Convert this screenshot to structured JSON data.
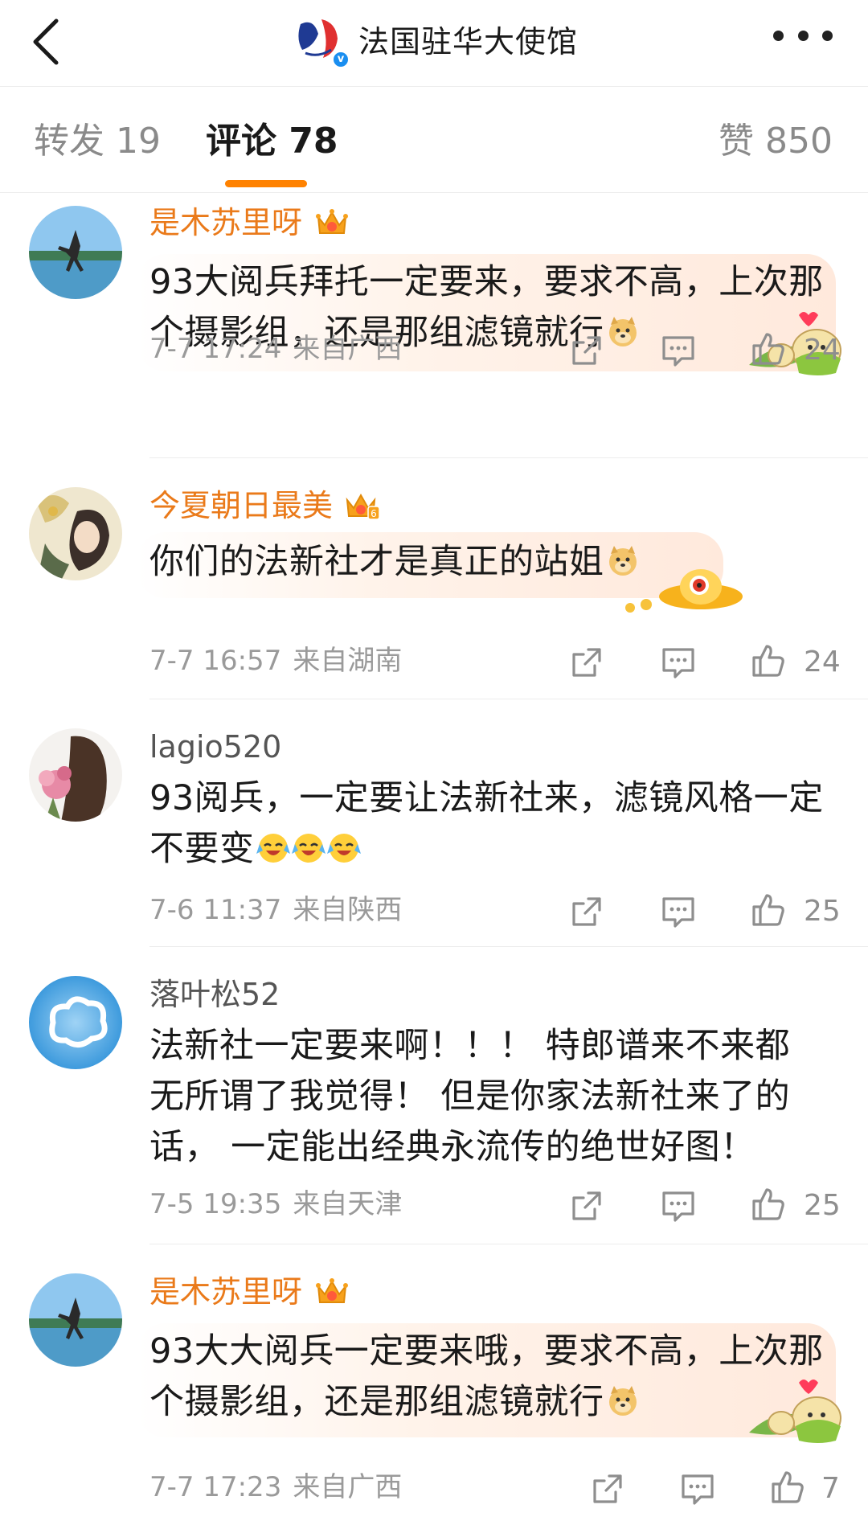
{
  "header": {
    "title": "法国驻华大使馆",
    "back_icon": "back-arrow-icon",
    "more_icon": "more-dots-icon",
    "verified_mark": "v"
  },
  "tabs": {
    "reposts": "转发 19",
    "comments": "评论 78",
    "likes": "赞 850",
    "active": "comments",
    "accent_color": "#ff8200"
  },
  "comments": [
    {
      "username": "是木苏里呀",
      "member": true,
      "text": "93大阅兵拜托一定要来，要求不高，上次那个摄影组，还是那组滤镜就行",
      "emoji": [
        "doge"
      ],
      "time": "7-7 17:24",
      "location": "来自广西",
      "likes": "24"
    },
    {
      "username": "今夏朝日最美",
      "member": true,
      "member_level": "6",
      "text": "你们的法新社才是真正的站姐",
      "emoji": [
        "doge"
      ],
      "time": "7-7 16:57",
      "location": "来自湖南",
      "likes": "24"
    },
    {
      "username": "lagio520",
      "member": false,
      "text": "93阅兵，一定要让法新社来，滤镜风格一定不要变",
      "emoji": [
        "cry-laugh",
        "cry-laugh",
        "cry-laugh"
      ],
      "time": "7-6 11:37",
      "location": "来自陕西",
      "likes": "25"
    },
    {
      "username": "落叶松52",
      "member": false,
      "text": "法新社一定要来啊！！！ 特郎谱来不来都无所谓了我觉得！ 但是你家法新社来了的话， 一定能出经典永流传的绝世好图！",
      "emoji": [],
      "time": "7-5 19:35",
      "location": "来自天津",
      "likes": "25"
    },
    {
      "username": "是木苏里呀",
      "member": true,
      "text": "93大大阅兵一定要来哦，要求不高，上次那个摄影组，还是那组滤镜就行",
      "emoji": [
        "doge"
      ],
      "time": "7-7 17:23",
      "location": "来自广西",
      "likes": "7"
    }
  ],
  "actions": {
    "share_icon": "share-icon",
    "reply_icon": "comment-icon",
    "like_icon": "thumbs-up-icon"
  },
  "colors": {
    "username_member": "#ea7a1a",
    "username_plain": "#555555",
    "meta_gray": "#9a9a9a"
  }
}
